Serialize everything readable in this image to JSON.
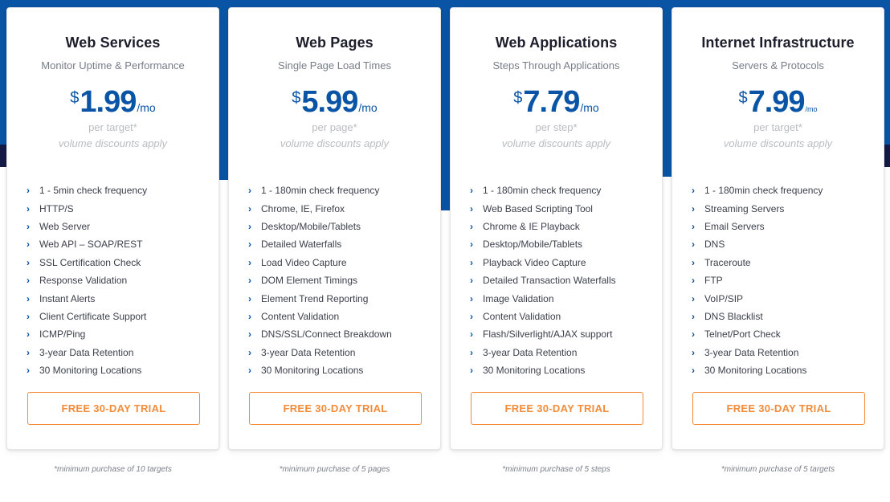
{
  "colors": {
    "brand_blue": "#0a54a6",
    "navy": "#151a46",
    "accent_orange": "#f28c3a"
  },
  "plans": [
    {
      "title": "Web Services",
      "subtitle": "Monitor Uptime & Performance",
      "currency": "$",
      "price": "1.99",
      "period": "/mo",
      "unit": "per target*",
      "discount": "volume discounts apply",
      "features": [
        "1 - 5min check frequency",
        "HTTP/S",
        "Web Server",
        "Web API – SOAP/REST",
        "SSL Certification Check",
        "Response Validation",
        "Instant Alerts",
        "Client Certificate Support",
        "ICMP/Ping",
        "3-year Data Retention",
        "30 Monitoring Locations"
      ],
      "cta": "FREE 30-DAY TRIAL",
      "footnote": "*minimum purchase of 10 targets"
    },
    {
      "title": "Web Pages",
      "subtitle": "Single Page Load Times",
      "currency": "$",
      "price": "5.99",
      "period": "/mo",
      "unit": "per page*",
      "discount": "volume discounts apply",
      "features": [
        "1 - 180min check frequency",
        "Chrome, IE, Firefox",
        "Desktop/Mobile/Tablets",
        "Detailed Waterfalls",
        "Load Video Capture",
        "DOM Element Timings",
        "Element Trend Reporting",
        "Content Validation",
        "DNS/SSL/Connect Breakdown",
        "3-year Data Retention",
        "30 Monitoring Locations"
      ],
      "cta": "FREE 30-DAY TRIAL",
      "footnote": "*minimum purchase of 5 pages"
    },
    {
      "title": "Web Applications",
      "subtitle": "Steps Through Applications",
      "currency": "$",
      "price": "7.79",
      "period": "/mo",
      "unit": "per step*",
      "discount": "volume discounts apply",
      "features": [
        "1 - 180min check frequency",
        "Web Based Scripting Tool",
        "Chrome & IE Playback",
        "Desktop/Mobile/Tablets",
        "Playback Video Capture",
        "Detailed Transaction Waterfalls",
        "Image Validation",
        "Content Validation",
        "Flash/Silverlight/AJAX support",
        "3-year Data Retention",
        "30 Monitoring Locations"
      ],
      "cta": "FREE 30-DAY TRIAL",
      "footnote": "*minimum purchase of 5 steps"
    },
    {
      "title": "Internet Infrastructure",
      "subtitle": "Servers & Protocols",
      "currency": "$",
      "price": "7.99",
      "period": "/mo",
      "unit": "per target*",
      "discount": "volume discounts apply",
      "features": [
        "1 - 180min check frequency",
        "Streaming Servers",
        "Email Servers",
        "DNS",
        "Traceroute",
        "FTP",
        "VoIP/SIP",
        "DNS Blacklist",
        "Telnet/Port Check",
        "3-year Data Retention",
        "30 Monitoring Locations"
      ],
      "cta": "FREE 30-DAY TRIAL",
      "footnote": "*minimum purchase of 5 targets"
    }
  ],
  "icons": {
    "feature_bullet": "chevron-right-icon",
    "chevron_glyph": "›"
  }
}
